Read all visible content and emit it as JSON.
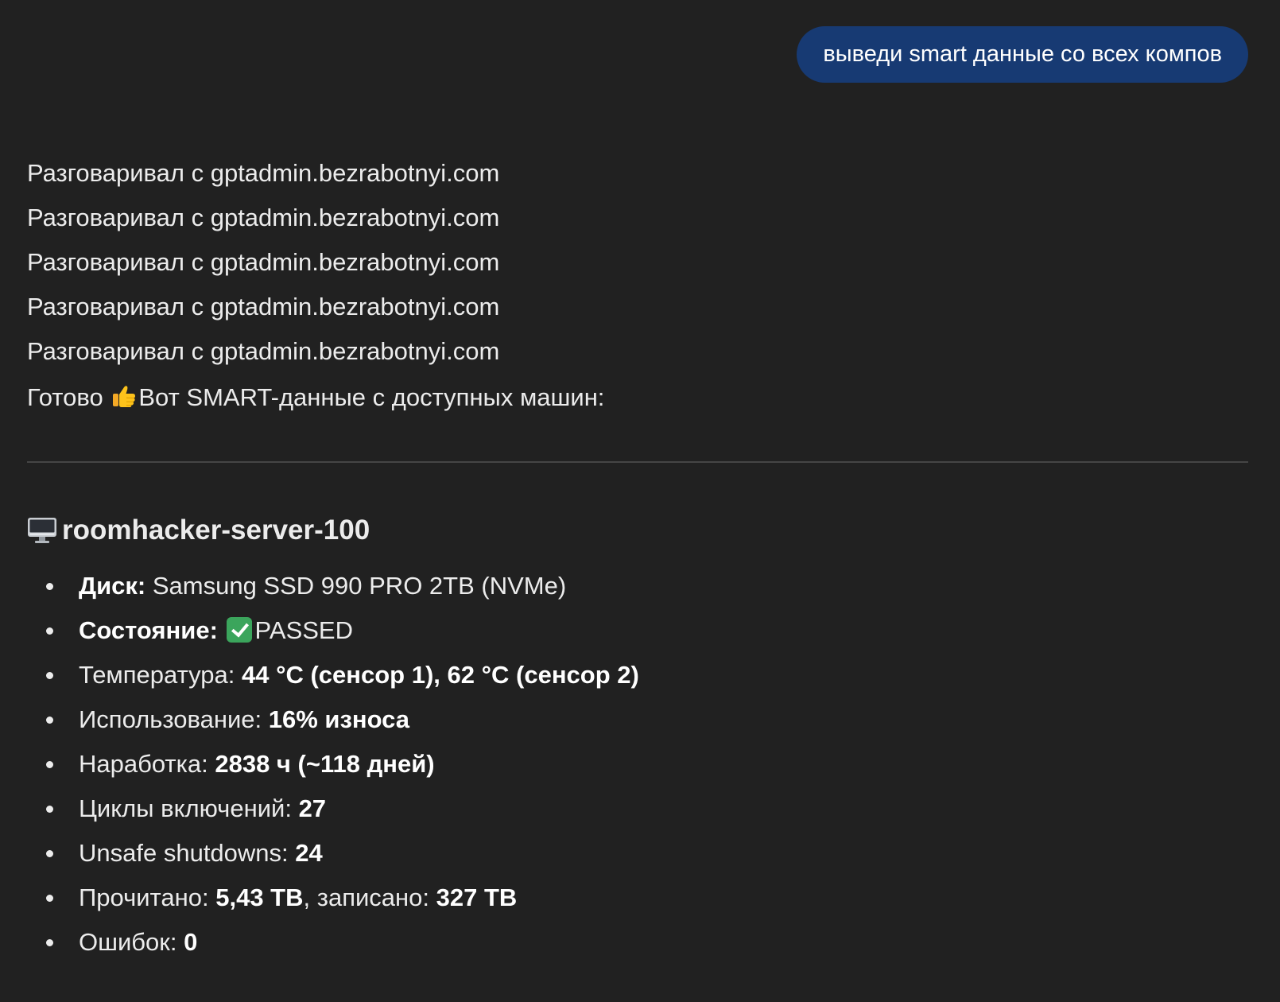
{
  "user_message": {
    "text": "выведи smart данные со всех компов"
  },
  "assistant": {
    "tool_calls": [
      "Разговаривал с gptadmin.bezrabotnyi.com",
      "Разговаривал с gptadmin.bezrabotnyi.com",
      "Разговаривал с gptadmin.bezrabotnyi.com",
      "Разговаривал с gptadmin.bezrabotnyi.com",
      "Разговаривал с gptadmin.bezrabotnyi.com"
    ],
    "intro": {
      "before": "Готово",
      "emoji": "thumbs-up",
      "after": "Вот SMART-данные с доступных машин:"
    },
    "host": {
      "icon": "desktop-computer-icon",
      "name": "roomhacker-server-100",
      "disk_label": "Диск:",
      "disk_value": "Samsung SSD 990 PRO 2TB (NVMe)",
      "status_label": "Состояние:",
      "status_icon": "check-mark-icon",
      "status_value": "PASSED",
      "temperature_label": "Температура: ",
      "temperature_value": "44 °C (сенсор 1), 62 °C (сенсор 2)",
      "usage_label": "Использование: ",
      "usage_value": "16% износа",
      "uptime_label": "Наработка: ",
      "uptime_value": "2838 ч (~118 дней)",
      "power_cycles_label": "Циклы включений: ",
      "power_cycles_value": "27",
      "unsafe_label": "Unsafe shutdowns: ",
      "unsafe_value": "24",
      "read_label": "Прочитано: ",
      "read_value": "5,43 TB",
      "written_label": ", записано: ",
      "written_value": "327 TB",
      "errors_label": "Ошибок: ",
      "errors_value": "0"
    }
  },
  "colors": {
    "background": "#212121",
    "user_bubble": "#173a73",
    "text": "#ececec",
    "divider": "#454545",
    "check": "#3ba55c"
  }
}
